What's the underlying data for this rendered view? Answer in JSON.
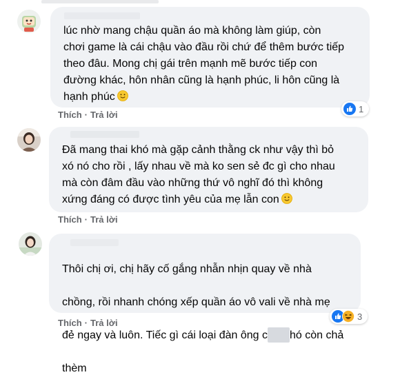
{
  "comments": [
    {
      "text": "lúc nhờ mang chậu quần áo mà không làm giúp, còn\nchơi game là cái chậu vào đầu rồi chứ để thêm bước tiếp\ntheo đâu. Mong chị gái trên mạnh mẽ bước tiếp con\nđường khác, hôn nhân cũng là hạnh phúc, li hôn cũng là\nhạnh phúc",
      "emoji": "slightly-smiling-face",
      "like_label": "Thích",
      "reply_label": "Trả lời",
      "reactions": [
        "like"
      ],
      "reaction_count": "1"
    },
    {
      "text": "Đã mang thai khó mà gặp cảnh thằng ck như vậy thì bỏ\nxó nó cho rồi , lấy nhau về mà ko sen sẻ đc gì cho nhau\nmà còn đâm đầu vào những thứ vô nghĩ đó thì không\nxứng đáng có được tình yêu của mẹ lẫn con",
      "emoji": "slightly-smiling-face",
      "like_label": "Thích",
      "reply_label": "Trả lời"
    },
    {
      "text_line1": "Thôi chị ơi, chị hãy cố gắng nhẫn nhịn quay về nhà",
      "text_line2": "chồng, rồi nhanh chóng xếp quần áo vô vali về nhà mẹ",
      "text_line3a": "đẻ ngay và luôn. Tiếc gì cái loại đàn ông c",
      "text_line3b": "hó còn chả",
      "text_line4": "thèm",
      "like_label": "Thích",
      "reply_label": "Trả lời",
      "reactions": [
        "like",
        "haha"
      ],
      "reaction_count": "3"
    }
  ],
  "colors": {
    "bubble": "#f0f2f5",
    "action_text": "#65676b",
    "like_blue": "#1877f2",
    "haha_yellow": "#f7b125"
  }
}
